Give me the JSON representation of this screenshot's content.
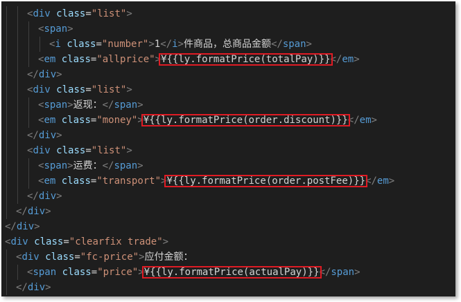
{
  "colors": {
    "background": "#1e1e1e",
    "tag_bracket": "#808080",
    "tag_name": "#569cd6",
    "attribute": "#9cdcfe",
    "string": "#ce9178",
    "text": "#d4d4d4",
    "highlight_box": "#e01b24"
  },
  "code_lines": [
    {
      "indent": 2,
      "tokens": [
        {
          "k": "t",
          "v": "<"
        },
        {
          "k": "n",
          "v": "div"
        },
        {
          "k": "c",
          "v": " "
        },
        {
          "k": "a",
          "v": "class"
        },
        {
          "k": "c",
          "v": "="
        },
        {
          "k": "s",
          "v": "\"list\""
        },
        {
          "k": "t",
          "v": ">"
        }
      ]
    },
    {
      "indent": 3,
      "tokens": [
        {
          "k": "t",
          "v": "<"
        },
        {
          "k": "n",
          "v": "span"
        },
        {
          "k": "t",
          "v": ">"
        }
      ]
    },
    {
      "indent": 4,
      "tokens": [
        {
          "k": "t",
          "v": "<"
        },
        {
          "k": "n",
          "v": "i"
        },
        {
          "k": "c",
          "v": " "
        },
        {
          "k": "a",
          "v": "class"
        },
        {
          "k": "c",
          "v": "="
        },
        {
          "k": "s",
          "v": "\"number\""
        },
        {
          "k": "t",
          "v": ">"
        },
        {
          "k": "c",
          "v": "1"
        },
        {
          "k": "t",
          "v": "</"
        },
        {
          "k": "n",
          "v": "i"
        },
        {
          "k": "t",
          "v": ">"
        },
        {
          "k": "c",
          "v": "件商品，总商品金额"
        },
        {
          "k": "t",
          "v": "</"
        },
        {
          "k": "n",
          "v": "span"
        },
        {
          "k": "t",
          "v": ">"
        }
      ]
    },
    {
      "indent": 3,
      "tokens": [
        {
          "k": "t",
          "v": "<"
        },
        {
          "k": "n",
          "v": "em"
        },
        {
          "k": "c",
          "v": " "
        },
        {
          "k": "a",
          "v": "class"
        },
        {
          "k": "c",
          "v": "="
        },
        {
          "k": "s",
          "v": "\"allprice\""
        },
        {
          "k": "t",
          "v": ">"
        },
        {
          "k": "c",
          "v": "¥{{ly.formatPrice(totalPay)}}",
          "hl": true
        },
        {
          "k": "t",
          "v": "</"
        },
        {
          "k": "n",
          "v": "em"
        },
        {
          "k": "t",
          "v": ">"
        }
      ]
    },
    {
      "indent": 2,
      "tokens": [
        {
          "k": "t",
          "v": "</"
        },
        {
          "k": "n",
          "v": "div"
        },
        {
          "k": "t",
          "v": ">"
        }
      ]
    },
    {
      "indent": 2,
      "tokens": [
        {
          "k": "t",
          "v": "<"
        },
        {
          "k": "n",
          "v": "div"
        },
        {
          "k": "c",
          "v": " "
        },
        {
          "k": "a",
          "v": "class"
        },
        {
          "k": "c",
          "v": "="
        },
        {
          "k": "s",
          "v": "\"list\""
        },
        {
          "k": "t",
          "v": ">"
        }
      ]
    },
    {
      "indent": 3,
      "tokens": [
        {
          "k": "t",
          "v": "<"
        },
        {
          "k": "n",
          "v": "span"
        },
        {
          "k": "t",
          "v": ">"
        },
        {
          "k": "c",
          "v": "返现："
        },
        {
          "k": "t",
          "v": "</"
        },
        {
          "k": "n",
          "v": "span"
        },
        {
          "k": "t",
          "v": ">"
        }
      ]
    },
    {
      "indent": 3,
      "tokens": [
        {
          "k": "t",
          "v": "<"
        },
        {
          "k": "n",
          "v": "em"
        },
        {
          "k": "c",
          "v": " "
        },
        {
          "k": "a",
          "v": "class"
        },
        {
          "k": "c",
          "v": "="
        },
        {
          "k": "s",
          "v": "\"money\""
        },
        {
          "k": "t",
          "v": ">"
        },
        {
          "k": "c",
          "v": "¥{{ly.formatPrice(order.discount)}}",
          "hl": true
        },
        {
          "k": "t",
          "v": "</"
        },
        {
          "k": "n",
          "v": "em"
        },
        {
          "k": "t",
          "v": ">"
        }
      ]
    },
    {
      "indent": 2,
      "tokens": [
        {
          "k": "t",
          "v": "</"
        },
        {
          "k": "n",
          "v": "div"
        },
        {
          "k": "t",
          "v": ">"
        }
      ]
    },
    {
      "indent": 2,
      "tokens": [
        {
          "k": "t",
          "v": "<"
        },
        {
          "k": "n",
          "v": "div"
        },
        {
          "k": "c",
          "v": " "
        },
        {
          "k": "a",
          "v": "class"
        },
        {
          "k": "c",
          "v": "="
        },
        {
          "k": "s",
          "v": "\"list\""
        },
        {
          "k": "t",
          "v": ">"
        }
      ]
    },
    {
      "indent": 3,
      "tokens": [
        {
          "k": "t",
          "v": "<"
        },
        {
          "k": "n",
          "v": "span"
        },
        {
          "k": "t",
          "v": ">"
        },
        {
          "k": "c",
          "v": "运费："
        },
        {
          "k": "t",
          "v": "</"
        },
        {
          "k": "n",
          "v": "span"
        },
        {
          "k": "t",
          "v": ">"
        }
      ]
    },
    {
      "indent": 3,
      "tokens": [
        {
          "k": "t",
          "v": "<"
        },
        {
          "k": "n",
          "v": "em"
        },
        {
          "k": "c",
          "v": " "
        },
        {
          "k": "a",
          "v": "class"
        },
        {
          "k": "c",
          "v": "="
        },
        {
          "k": "s",
          "v": "\"transport\""
        },
        {
          "k": "t",
          "v": ">"
        },
        {
          "k": "c",
          "v": "¥{{ly.formatPrice(order.postFee)}}",
          "hl": true
        },
        {
          "k": "t",
          "v": "</"
        },
        {
          "k": "n",
          "v": "em"
        },
        {
          "k": "t",
          "v": ">"
        }
      ]
    },
    {
      "indent": 2,
      "tokens": [
        {
          "k": "t",
          "v": "</"
        },
        {
          "k": "n",
          "v": "div"
        },
        {
          "k": "t",
          "v": ">"
        }
      ]
    },
    {
      "indent": 1,
      "tokens": [
        {
          "k": "t",
          "v": "</"
        },
        {
          "k": "n",
          "v": "div"
        },
        {
          "k": "t",
          "v": ">"
        }
      ]
    },
    {
      "indent": 0,
      "tokens": [
        {
          "k": "t",
          "v": "</"
        },
        {
          "k": "n",
          "v": "div"
        },
        {
          "k": "t",
          "v": ">"
        }
      ]
    },
    {
      "indent": 0,
      "tokens": [
        {
          "k": "t",
          "v": "<"
        },
        {
          "k": "n",
          "v": "div"
        },
        {
          "k": "c",
          "v": " "
        },
        {
          "k": "a",
          "v": "class"
        },
        {
          "k": "c",
          "v": "="
        },
        {
          "k": "s",
          "v": "\"clearfix trade\""
        },
        {
          "k": "t",
          "v": ">"
        }
      ]
    },
    {
      "indent": 1,
      "tokens": [
        {
          "k": "t",
          "v": "<"
        },
        {
          "k": "n",
          "v": "div"
        },
        {
          "k": "c",
          "v": " "
        },
        {
          "k": "a",
          "v": "class"
        },
        {
          "k": "c",
          "v": "="
        },
        {
          "k": "s",
          "v": "\"fc-price\""
        },
        {
          "k": "t",
          "v": ">"
        },
        {
          "k": "c",
          "v": "应付金额："
        }
      ]
    },
    {
      "indent": 2,
      "tokens": [
        {
          "k": "t",
          "v": "<"
        },
        {
          "k": "n",
          "v": "span"
        },
        {
          "k": "c",
          "v": " "
        },
        {
          "k": "a",
          "v": "class"
        },
        {
          "k": "c",
          "v": "="
        },
        {
          "k": "s",
          "v": "\"price\""
        },
        {
          "k": "t",
          "v": ">"
        },
        {
          "k": "c",
          "v": "¥{{ly.formatPrice(actualPay)}}",
          "hl": true
        },
        {
          "k": "t",
          "v": "</"
        },
        {
          "k": "n",
          "v": "span"
        },
        {
          "k": "t",
          "v": ">"
        }
      ]
    },
    {
      "indent": 1,
      "tokens": [
        {
          "k": "t",
          "v": "</"
        },
        {
          "k": "n",
          "v": "div"
        },
        {
          "k": "t",
          "v": ">"
        }
      ]
    }
  ]
}
